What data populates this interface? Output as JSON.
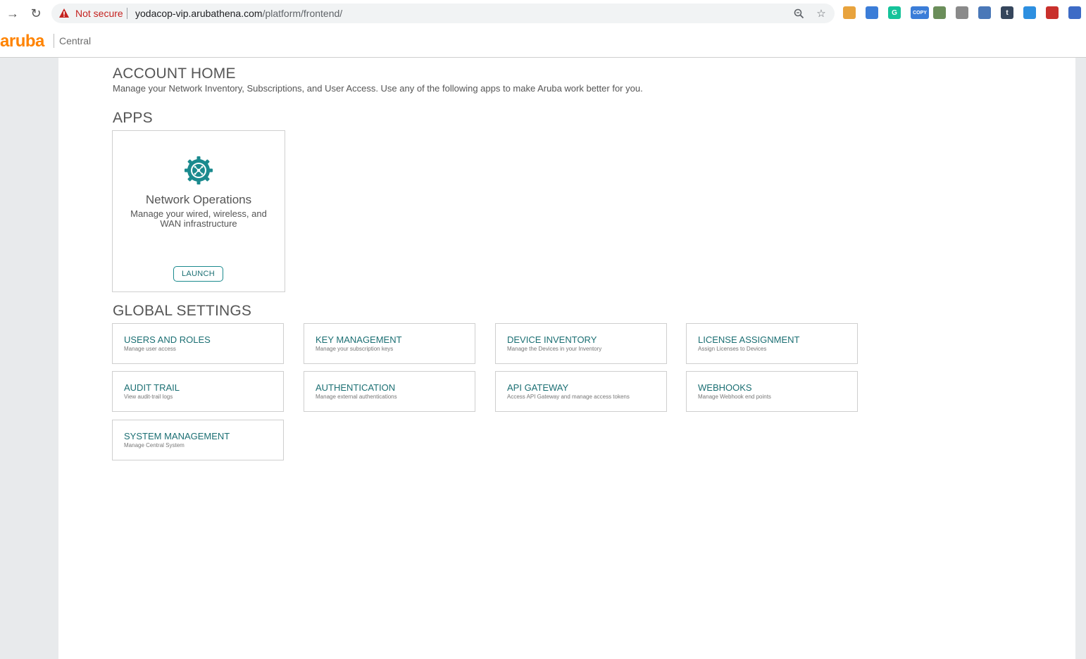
{
  "browser": {
    "not_secure_label": "Not secure",
    "url_host": "yodacop-vip.arubathena.com",
    "url_path": "/platform/frontend/",
    "extensions": [
      {
        "icon": "pen-icon",
        "color": "#e8a33d"
      },
      {
        "icon": "spellcheck-icon",
        "color": "#3b7dd8"
      },
      {
        "icon": "grammarly-icon",
        "color": "#15c39a",
        "glyph": "G"
      },
      {
        "icon": "copy-icon",
        "color": "#3b7dd8",
        "glyph": "COPY"
      },
      {
        "icon": "globe-icon",
        "color": "#6b8e5a"
      },
      {
        "icon": "translate-icon",
        "color": "#8a8a8a"
      },
      {
        "icon": "camera-icon",
        "color": "#4a78b8"
      },
      {
        "icon": "tumblr-icon",
        "color": "#35465c",
        "glyph": "t"
      },
      {
        "icon": "chat-icon",
        "color": "#2d8fe0"
      },
      {
        "icon": "pdf-icon",
        "color": "#c9302c"
      },
      {
        "icon": "extension-icon",
        "color": "#3d6bc6"
      }
    ]
  },
  "header": {
    "logo": "aruba",
    "product": "Central"
  },
  "account_home": {
    "title": "ACCOUNT HOME",
    "subtitle": "Manage your Network Inventory, Subscriptions, and User Access. Use any of the following apps to make Aruba work better for you."
  },
  "apps": {
    "title": "APPS",
    "card": {
      "icon": "network-operations-gear-icon",
      "name": "Network Operations",
      "description": "Manage your wired, wireless, and WAN infrastructure",
      "button": "LAUNCH"
    }
  },
  "global_settings": {
    "title": "GLOBAL SETTINGS",
    "tiles": [
      {
        "title": "USERS AND ROLES",
        "desc": "Manage user access"
      },
      {
        "title": "KEY MANAGEMENT",
        "desc": "Manage your subscription keys"
      },
      {
        "title": "DEVICE INVENTORY",
        "desc": "Manage the Devices in your Inventory"
      },
      {
        "title": "LICENSE ASSIGNMENT",
        "desc": "Assign Licenses to Devices"
      },
      {
        "title": "AUDIT TRAIL",
        "desc": "View audit-trail logs"
      },
      {
        "title": "AUTHENTICATION",
        "desc": "Manage external authentications"
      },
      {
        "title": "API GATEWAY",
        "desc": "Access API Gateway and manage access tokens"
      },
      {
        "title": "WEBHOOKS",
        "desc": "Manage Webhook end points"
      },
      {
        "title": "SYSTEM MANAGEMENT",
        "desc": "Manage Central System"
      }
    ]
  },
  "colors": {
    "brand": "#ff8300",
    "accent": "#1b6f73",
    "gear": "#1b8a8e"
  }
}
